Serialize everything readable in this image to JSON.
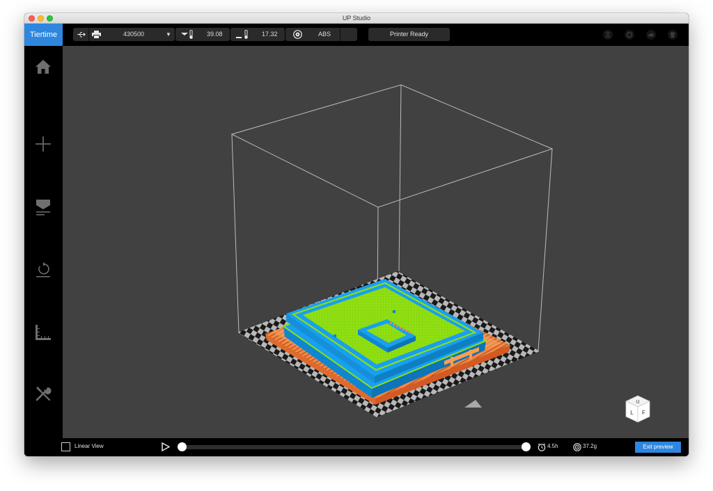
{
  "window": {
    "title": "UP Studio"
  },
  "logo": {
    "text": "Tiertime"
  },
  "topbar": {
    "printer_id": "430500",
    "nozzle_temp": "39.08",
    "bed_temp": "17.32",
    "material": "ABS",
    "status": "Printer Ready"
  },
  "sidebar": {
    "items": [
      {
        "icon": "home-icon"
      },
      {
        "icon": "add-icon"
      },
      {
        "icon": "print-icon"
      },
      {
        "icon": "initialize-icon"
      },
      {
        "icon": "calibrate-icon"
      },
      {
        "icon": "maintenance-icon"
      }
    ]
  },
  "viewcube": {
    "top": "U",
    "left": "L",
    "front": "F"
  },
  "bottombar": {
    "linear_view_label": "Linear View",
    "linear_view_checked": false,
    "time": "4.5h",
    "weight": "37.2g",
    "exit_label": "Exit preview"
  },
  "colors": {
    "accent": "#2e86de",
    "viewport": "#414141",
    "model_blue": "#18a0f0",
    "model_green": "#8fde12",
    "support_orange": "#f08a46"
  }
}
